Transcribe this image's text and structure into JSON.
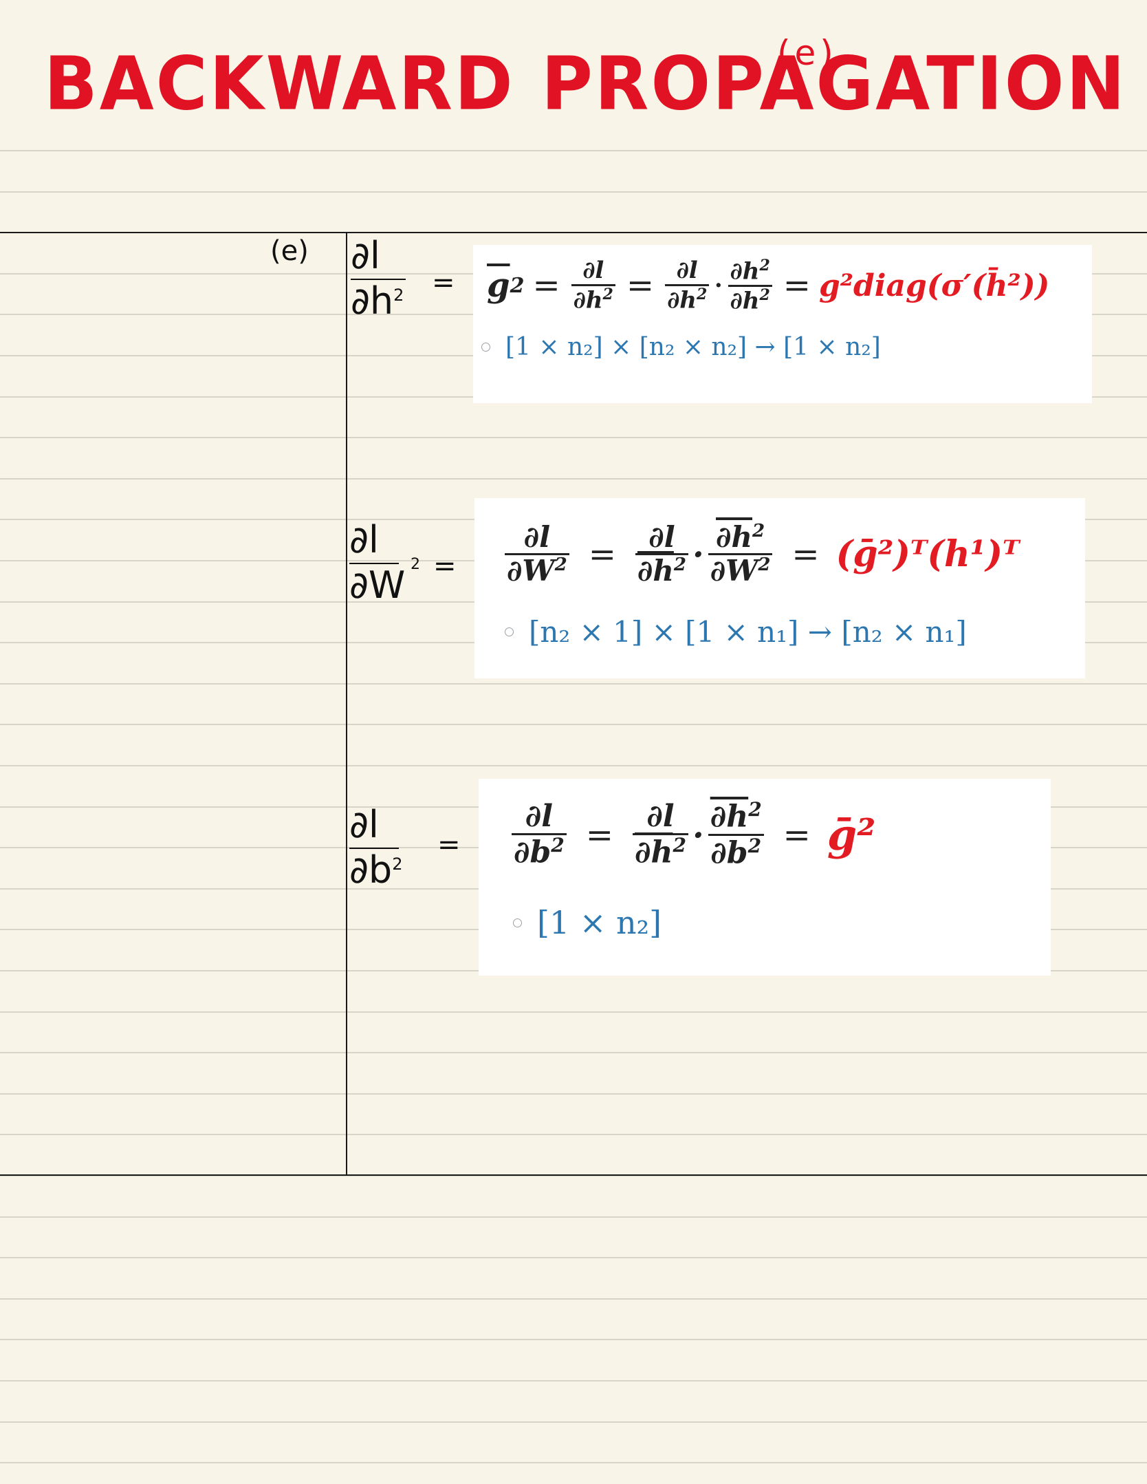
{
  "title": "BACKWARD PROPAGATION",
  "title_tag": "(e)",
  "section_label": "(e)",
  "items": [
    {
      "lhs_num": "∂l",
      "lhs_den": "∂h",
      "lhs_den_sup": "2",
      "lhs_eq": "=",
      "g_sym": "g",
      "g_sup": "2",
      "eq1": "=",
      "f1_num": "∂l",
      "f1_den": "∂h",
      "f1_den_sup": "2",
      "eq2": "=",
      "f2_num": "∂l",
      "f2_den": "∂h",
      "f2_den_sup": "2",
      "dot": "·",
      "f3_num": "∂h",
      "f3_num_sup": "2",
      "f3_den": "∂h",
      "f3_den_sup": "2",
      "eq3": "=",
      "result": "g²diag(σ′(h̄²))",
      "dims": "[1 × n₂] × [n₂ × n₂] → [1 × n₂]"
    },
    {
      "lhs_num": "∂l",
      "lhs_den": "∂W",
      "lhs_den_sup": "2",
      "lhs_eq": "=",
      "f1_num": "∂l",
      "f1_den": "∂W",
      "f1_den_sup": "2",
      "eq1": "=",
      "f2_num": "∂l",
      "f2_den": "∂h",
      "f2_den_sup": "2",
      "dot": "·",
      "f3_num": "∂h",
      "f3_num_sup": "2",
      "f3_den": "∂W",
      "f3_den_sup": "2",
      "eq2": "=",
      "result": "(ḡ²)ᵀ(h¹)ᵀ",
      "dims": "[n₂ × 1] × [1 × n₁] → [n₂ × n₁]"
    },
    {
      "lhs_num": "∂l",
      "lhs_den": "∂b",
      "lhs_den_sup": "2",
      "lhs_eq": "=",
      "f1_num": "∂l",
      "f1_den": "∂b",
      "f1_den_sup": "2",
      "eq1": "=",
      "f2_num": "∂l",
      "f2_den": "∂h",
      "f2_den_sup": "2",
      "dot": "·",
      "f3_num": "∂h",
      "f3_num_sup": "2",
      "f3_den": "∂b",
      "f3_den_sup": "2",
      "eq2": "=",
      "result": "ḡ²",
      "dims": "[1 × n₂]"
    }
  ]
}
